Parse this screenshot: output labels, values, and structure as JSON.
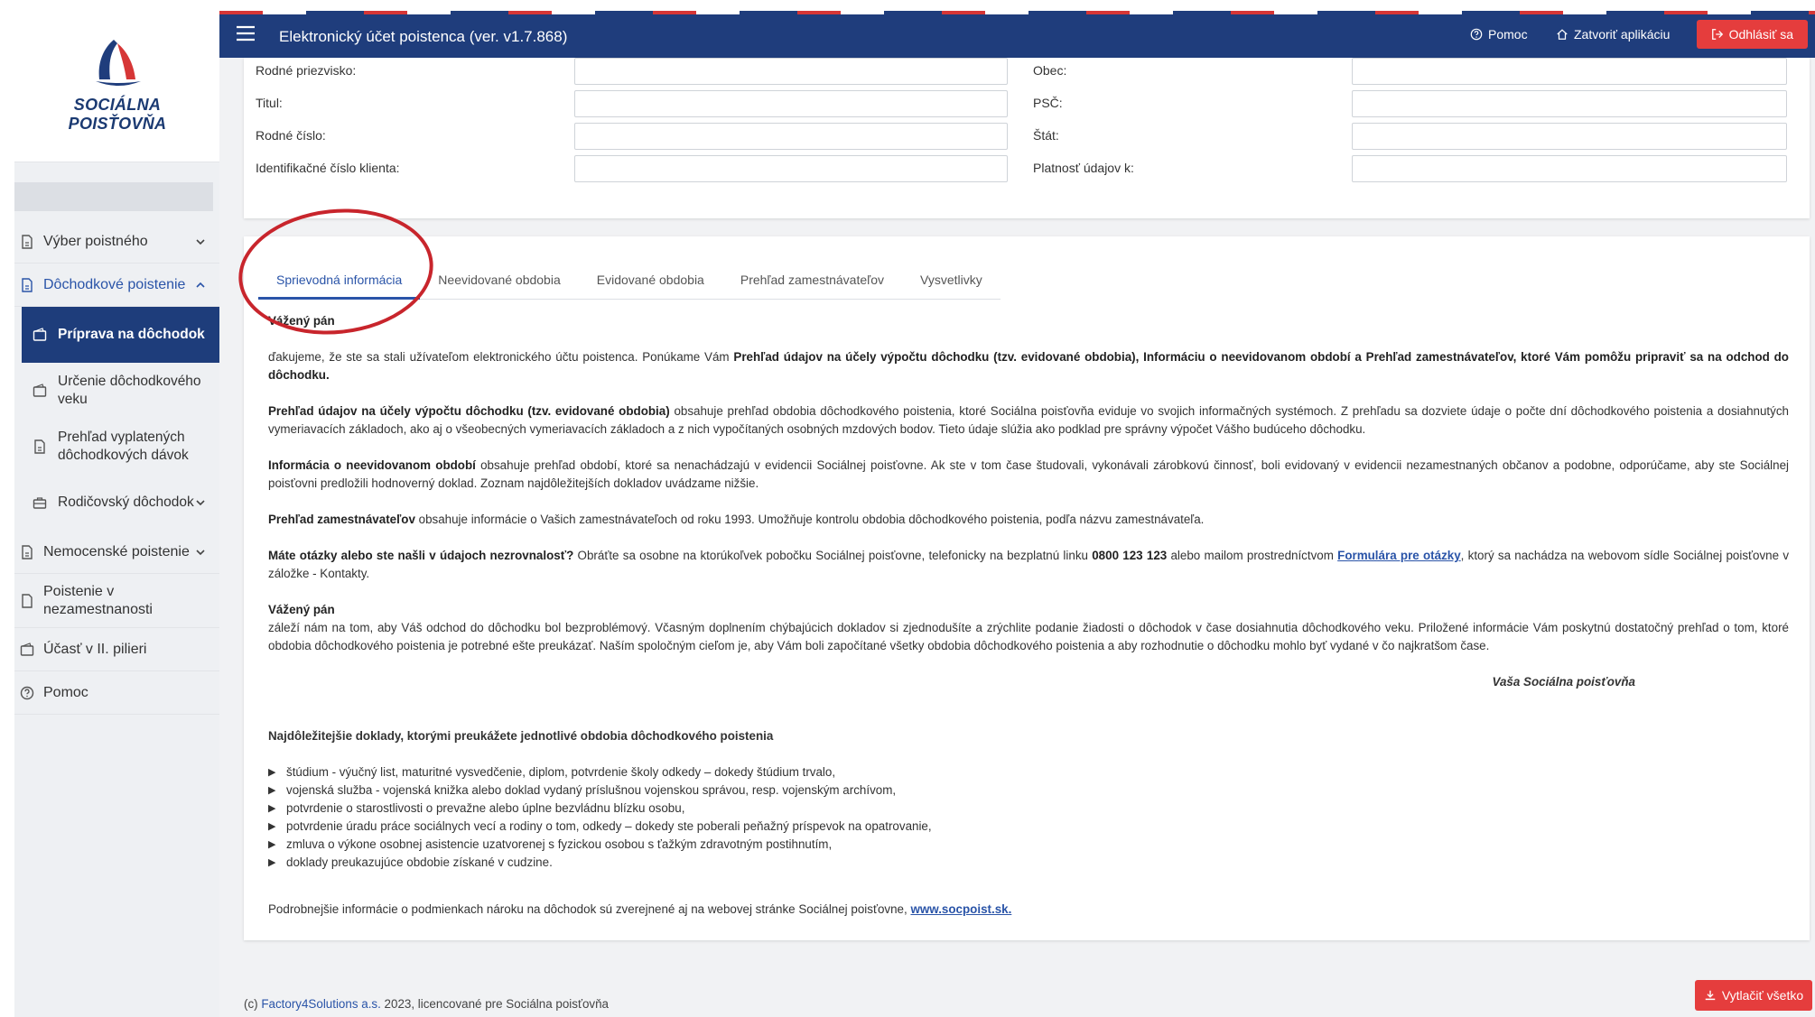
{
  "sidebar": {
    "logo_text": "SOCIÁLNA POISŤOVŇA",
    "items": [
      {
        "label": "Výber poistného",
        "icon": "document-icon",
        "chevron": "down"
      },
      {
        "label": "Dôchodkové poistenie",
        "icon": "document-icon",
        "chevron": "up",
        "open": true
      },
      {
        "label": "Nemocenské poistenie",
        "icon": "document-icon",
        "chevron": "down"
      },
      {
        "label": "Poistenie v nezamestnanosti",
        "icon": "document-icon"
      },
      {
        "label": "Účasť v II. pilieri",
        "icon": "wallet-icon"
      },
      {
        "label": "Pomoc",
        "icon": "help-icon"
      }
    ],
    "subitems": [
      {
        "label": "Príprava na dôchodok",
        "active": true
      },
      {
        "label": "Určenie dôchodkového veku"
      },
      {
        "label": "Prehľad vyplatených dôchodkových dávok"
      },
      {
        "label": "Rodičovský dôchodok",
        "chevron": "down"
      }
    ]
  },
  "header": {
    "title": "Elektronický účet poistenca (ver. v1.7.868)",
    "help": "Pomoc",
    "close_app": "Zatvoriť aplikáciu",
    "logout": "Odhlásiť sa"
  },
  "form": {
    "left": [
      {
        "label": "Rodné priezvisko:",
        "value": ""
      },
      {
        "label": "Titul:",
        "value": ""
      },
      {
        "label": "Rodné číslo:",
        "value": ""
      },
      {
        "label": "Identifikačné číslo klienta:",
        "value": ""
      }
    ],
    "right": [
      {
        "label": "Obec:",
        "value": ""
      },
      {
        "label": "PSČ:",
        "value": ""
      },
      {
        "label": "Štát:",
        "value": ""
      },
      {
        "label": "Platnosť údajov k:",
        "value": ""
      }
    ]
  },
  "tabs": [
    {
      "label": "Sprievodná informácia",
      "active": true
    },
    {
      "label": "Neevidované obdobia"
    },
    {
      "label": "Evidované obdobia"
    },
    {
      "label": "Prehľad zamestnávateľov"
    },
    {
      "label": "Vysvetlivky"
    }
  ],
  "content": {
    "greeting": "Vážený pán",
    "p1_a": "ďakujeme, že ste sa stali užívateľom elektronického účtu poistenca. Ponúkame Vám ",
    "p1_b": "Prehľad údajov na účely výpočtu dôchodku (tzv. evidované obdobia), Informáciu o neevidovanom období a Prehľad zamestnávateľov, ktoré Vám pomôžu pripraviť sa na odchod do dôchodku.",
    "p2_b": "Prehľad údajov na účely výpočtu dôchodku (tzv. evidované obdobia)",
    "p2_a": " obsahuje prehľad obdobia dôchodkového poistenia, ktoré Sociálna poisťovňa eviduje vo svojich informačných systémoch. Z prehľadu sa dozviete údaje o počte dní dôchodkového poistenia a dosiahnutých vymeriavacích základoch, ako aj o všeobecných vymeriavacích základoch a z nich vypočítaných osobných mzdových bodov. Tieto údaje slúžia ako podklad pre správny výpočet Vášho budúceho dôchodku.",
    "p3_b": "Informácia o neevidovanom období",
    "p3_a": " obsahuje prehľad období, ktoré sa nenachádzajú v evidencii Sociálnej poisťovne. Ak ste v tom čase študovali, vykonávali zárobkovú činnosť, boli evidovaný v evidencii nezamestnaných občanov a podobne, odporúčame, aby ste Sociálnej poisťovni predložili hodnoverný doklad. Zoznam najdôležitejších dokladov uvádzame nižšie.",
    "p4_b": "Prehľad zamestnávateľov",
    "p4_a": " obsahuje informácie o Vašich zamestnávateľoch od roku 1993. Umožňuje kontrolu obdobia dôchodkového poistenia, podľa názvu zamestnávateľa.",
    "p5_b": "Máte otázky alebo ste našli v údajoch nezrovnalosť?",
    "p5_a": " Obráťte sa osobne na ktorúkoľvek pobočku Sociálnej poisťovne, telefonicky na bezplatnú linku ",
    "p5_phone": "0800 123 123",
    "p5_c": " alebo mailom prostredníctvom ",
    "p5_link": "Formulára pre otázky",
    "p5_d": ", ktorý sa nachádza na webovom sídle Sociálnej poisťovne v záložke - Kontakty.",
    "greeting2": "Vážený pán",
    "p6": "záleží nám na tom, aby Váš odchod do dôchodku bol bezproblémový. Včasným doplnením chýbajúcich dokladov si zjednodušíte a zrýchlite podanie žiadosti o dôchodok v čase dosiahnutia dôchodkového veku. Priložené informácie Vám poskytnú dostatočný prehľad o tom, ktoré obdobia dôchodkového poistenia je potrebné ešte preukázať. Naším spoločným cieľom je, aby Vám boli započítané všetky obdobia dôchodkového poistenia a aby rozhodnutie o dôchodku mohlo byť vydané v čo najkratšom čase.",
    "signature": "Vaša Sociálna poisťovňa",
    "docs_title": "Najdôležitejšie doklady, ktorými preukážete jednotlivé obdobia dôchodkového poistenia",
    "docs": [
      "štúdium - výučný list, maturitné vysvedčenie, diplom, potvrdenie školy odkedy – dokedy štúdium trvalo,",
      "vojenská služba - vojenská knižka alebo doklad vydaný príslušnou vojenskou správou, resp. vojenským archívom,",
      "potvrdenie o starostlivosti o prevažne alebo úplne bezvládnu blízku osobu,",
      "potvrdenie úradu práce sociálnych vecí a rodiny o tom, odkedy – dokedy ste poberali peňažný príspevok na opatrovanie,",
      "zmluva o výkone osobnej asistencie uzatvorenej s fyzickou osobou s ťažkým zdravotným postihnutím,",
      "doklady preukazujúce obdobie získané v cudzine."
    ],
    "more_a": "Podrobnejšie informácie o podmienkach nároku na dôchodok sú zverejnené aj na webovej stránke Sociálnej poisťovne, ",
    "more_link": "www.socpoist.sk."
  },
  "footer": {
    "prefix": "(c) ",
    "company": "Factory4Solutions a.s.",
    "suffix": " 2023, licencované pre Sociálna poisťovňa"
  },
  "print_button": "Vytlačiť všetko",
  "colors": {
    "primary": "#1f3d7c",
    "accent": "#e53d3d",
    "link": "#2a54a8",
    "annotation": "#c8252c"
  }
}
